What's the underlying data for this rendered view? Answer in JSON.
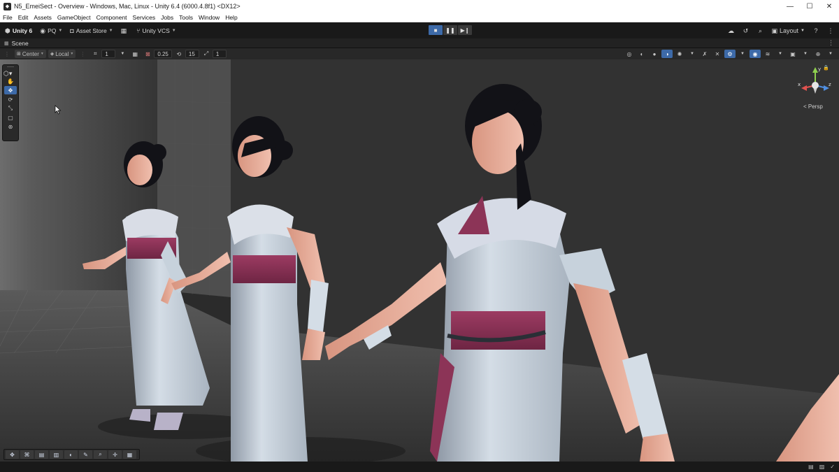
{
  "window": {
    "title": "N5_EmeiSect - Overview - Windows, Mac, Linux - Unity 6.4 (6000.4.8f1) <DX12>",
    "minimize": "—",
    "maximize": "☐",
    "close": "✕"
  },
  "menu": [
    "File",
    "Edit",
    "Assets",
    "GameObject",
    "Component",
    "Services",
    "Jobs",
    "Tools",
    "Window",
    "Help"
  ],
  "toolbar": {
    "unity_label": "Unity 6",
    "account_label": "PQ",
    "asset_store_label": "Asset Store",
    "vcs_label": "Unity VCS",
    "layout_label": "Layout"
  },
  "scene_tab": {
    "label": "Scene"
  },
  "scene_toolbar": {
    "pivot_label": "Center",
    "space_label": "Local",
    "grid_value": "1",
    "snap_value": "0.25",
    "angle_value": "15",
    "scale_value": "1"
  },
  "viewport": {
    "persp_label": "< Persp",
    "gizmo_axes": {
      "y": "y",
      "x": "x",
      "z": "z"
    }
  },
  "colors": {
    "accent": "#3d6aa8",
    "background": "#191919",
    "outfit_white": "#c7d2dc",
    "sash": "#8c3457",
    "hair": "#121217",
    "skin": "#e2a892"
  }
}
